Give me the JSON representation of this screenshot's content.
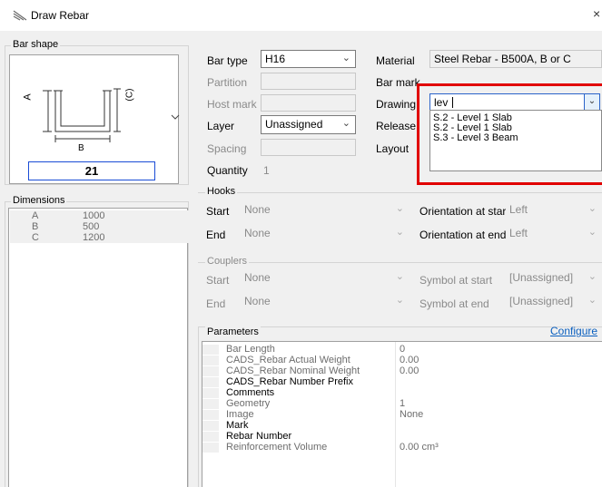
{
  "window": {
    "title": "Draw Rebar",
    "close_glyph": "×"
  },
  "bar_shape": {
    "group_label": "Bar shape",
    "labels": {
      "a": "A",
      "b": "B",
      "c": "(C)"
    },
    "shape_number": "21"
  },
  "dimensions": {
    "group_label": "Dimensions",
    "rows": [
      {
        "name": "A",
        "value": "1000"
      },
      {
        "name": "B",
        "value": "500"
      },
      {
        "name": "C",
        "value": "1200"
      }
    ]
  },
  "fields": {
    "bar_type": {
      "label": "Bar type",
      "value": "H16"
    },
    "partition": {
      "label": "Partition",
      "value": ""
    },
    "host_mark": {
      "label": "Host mark",
      "value": ""
    },
    "layer": {
      "label": "Layer",
      "value": "Unassigned"
    },
    "spacing": {
      "label": "Spacing",
      "value": ""
    },
    "quantity": {
      "label": "Quantity",
      "value": "1"
    },
    "material": {
      "label": "Material",
      "value": "Steel Rebar - B500A, B or C"
    },
    "bar_mark": {
      "label": "Bar mark"
    },
    "drawing": {
      "label": "Drawing",
      "value": "lev"
    },
    "release": {
      "label": "Release"
    },
    "layout": {
      "label": "Layout"
    }
  },
  "drawing_dropdown": {
    "options": [
      "S.2 - Level 1 Slab",
      "S.2 - Level 1 Slab",
      "S.3 - Level 3 Beam"
    ]
  },
  "hooks": {
    "group_label": "Hooks",
    "start": {
      "label": "Start",
      "value": "None"
    },
    "end": {
      "label": "End",
      "value": "None"
    },
    "orient_start": {
      "label": "Orientation at start",
      "value": "Left"
    },
    "orient_end": {
      "label": "Orientation at end",
      "value": "Left"
    }
  },
  "couplers": {
    "group_label": "Couplers",
    "start": {
      "label": "Start",
      "value": "None"
    },
    "end": {
      "label": "End",
      "value": "None"
    },
    "symbol_start": {
      "label": "Symbol at start",
      "value": "[Unassigned]"
    },
    "symbol_end": {
      "label": "Symbol at end",
      "value": "[Unassigned]"
    }
  },
  "parameters": {
    "group_label": "Parameters",
    "configure_label": "Configure",
    "rows": [
      {
        "name": "Bar Length",
        "value": "0",
        "bold": false
      },
      {
        "name": "CADS_Rebar Actual Weight",
        "value": "0.00",
        "bold": false
      },
      {
        "name": "CADS_Rebar Nominal Weight",
        "value": "0.00",
        "bold": false
      },
      {
        "name": "CADS_Rebar Number Prefix",
        "value": "",
        "bold": true
      },
      {
        "name": "Comments",
        "value": "",
        "bold": true
      },
      {
        "name": "Geometry",
        "value": "1",
        "bold": false
      },
      {
        "name": "Image",
        "value": "None",
        "bold": false
      },
      {
        "name": "Mark",
        "value": "",
        "bold": true
      },
      {
        "name": "Rebar Number",
        "value": "",
        "bold": true
      },
      {
        "name": "Reinforcement Volume",
        "value": "0.00 cm³",
        "bold": false
      }
    ]
  },
  "colors": {
    "highlight_border": "#e10000",
    "link": "#0a5fbf"
  }
}
